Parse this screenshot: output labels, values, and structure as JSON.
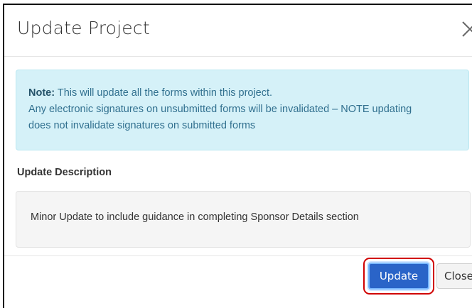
{
  "modal": {
    "title": "Update Project",
    "close_icon": "close-icon"
  },
  "note": {
    "label": "Note:",
    "line1": "This will update all the forms within this project.",
    "line2": "Any electronic signatures on unsubmitted forms will be invalidated – NOTE updating",
    "line3": "does not invalidate signatures on submitted forms"
  },
  "description": {
    "label": "Update Description",
    "text": "Minor Update to include guidance in completing Sponsor Details section"
  },
  "footer": {
    "update_label": "Update",
    "close_label": "Close"
  },
  "colors": {
    "note_background": "#d5f1f8",
    "note_text": "#31708f",
    "primary_button": "#2a64c8",
    "highlight_ring": "#d00000"
  }
}
